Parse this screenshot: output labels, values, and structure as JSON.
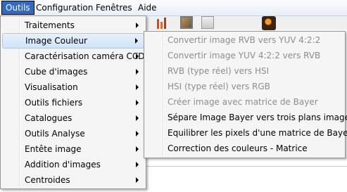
{
  "menubar": {
    "items": [
      {
        "label": "Outils",
        "active": true
      },
      {
        "label": "Configuration",
        "active": false
      },
      {
        "label": "Fenêtres",
        "active": false
      },
      {
        "label": "Aide",
        "active": false
      }
    ]
  },
  "outils_menu": {
    "items": [
      {
        "label": "Traitements",
        "has_submenu": true,
        "highlighted": false
      },
      {
        "label": "Image Couleur",
        "has_submenu": true,
        "highlighted": true
      },
      {
        "label": "Caractérisation caméra CCD",
        "has_submenu": true,
        "highlighted": false
      },
      {
        "label": "Cube d'images",
        "has_submenu": true,
        "highlighted": false
      },
      {
        "label": "Visualisation",
        "has_submenu": true,
        "highlighted": false
      },
      {
        "label": "Outils fichiers",
        "has_submenu": true,
        "highlighted": false
      },
      {
        "label": "Catalogues",
        "has_submenu": true,
        "highlighted": false
      },
      {
        "label": "Outils Analyse",
        "has_submenu": true,
        "highlighted": false
      },
      {
        "label": "Entête image",
        "has_submenu": true,
        "highlighted": false
      },
      {
        "label": "Addition d'images",
        "has_submenu": true,
        "highlighted": false
      },
      {
        "label": "Centroides",
        "has_submenu": true,
        "highlighted": false
      }
    ]
  },
  "image_couleur_submenu": {
    "items": [
      {
        "label": "Convertir image RVB vers YUV 4:2:2",
        "enabled": false
      },
      {
        "label": "Convertir image YUV 4:2:2 vers RVB",
        "enabled": false
      },
      {
        "label": "RVB (type réel) vers HSI",
        "enabled": false
      },
      {
        "label": "HSI (type réel) vers RGB",
        "enabled": false
      },
      {
        "label": "Créer image avec matrice de Bayer",
        "enabled": false
      },
      {
        "label": "Sépare Image Bayer vers trois plans images",
        "enabled": true
      },
      {
        "label": "Equilibrer les pixels d'une matrice de Bayer",
        "enabled": true
      },
      {
        "label": "Correction des couleurs - Matrice",
        "enabled": true
      }
    ]
  },
  "colors": {
    "menubar_active": "#316ac5",
    "highlight": "#d3e4f8",
    "highlight_border": "#a8c8ec",
    "disabled_text": "#8d8d8d",
    "menu_background": "#f5f5f5"
  },
  "icons": {
    "submenu_arrow": "chevron-right-icon",
    "toolbar": [
      "chart-icon",
      "picture-frame-icon",
      "blank-box-icon",
      "orb-icon"
    ]
  }
}
